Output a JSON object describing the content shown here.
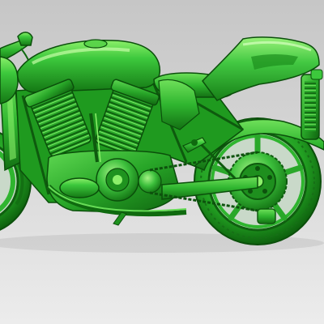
{
  "viewport": {
    "background_top": "#c6c6c6",
    "background_bottom": "#ececec"
  },
  "model": {
    "subject": "motorcycle-3d-model",
    "shading": "solid-green",
    "colors": {
      "base": "#2fb52f",
      "highlight": "#8cf06a",
      "shadow": "#0f6a0f",
      "outline": "#0b4f0b"
    }
  }
}
